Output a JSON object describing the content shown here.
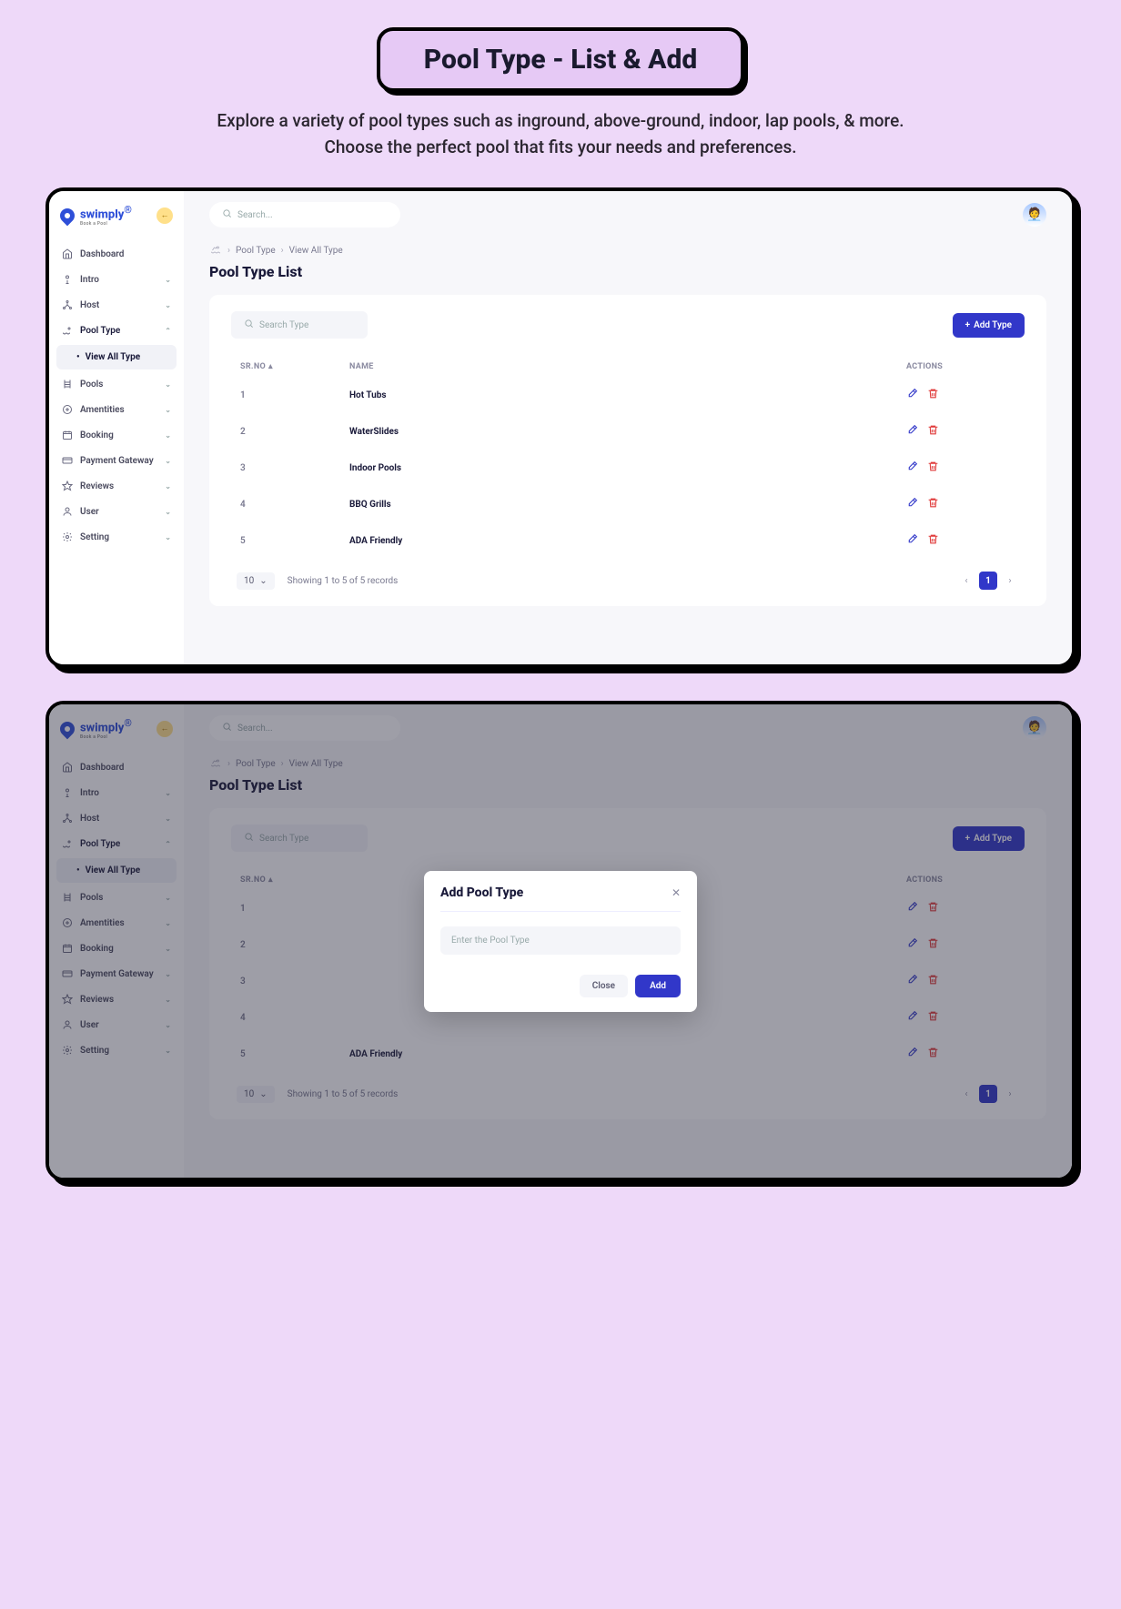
{
  "header": {
    "title": "Pool Type -  List & Add",
    "subtitle": "Explore a variety of pool types such as inground, above-ground, indoor, lap pools, & more. Choose the perfect pool that fits your needs and preferences."
  },
  "logo": {
    "name": "swimply",
    "tag": "Book a Pool",
    "trademark": "®"
  },
  "nav": {
    "items": [
      {
        "label": "Dashboard",
        "icon": "home",
        "expandable": false
      },
      {
        "label": "Intro",
        "icon": "person",
        "expandable": true
      },
      {
        "label": "Host",
        "icon": "network",
        "expandable": true
      },
      {
        "label": "Pool Type",
        "icon": "pool",
        "expandable": true,
        "open": true
      },
      {
        "label": "Pools",
        "icon": "ladder",
        "expandable": true
      },
      {
        "label": "Amentities",
        "icon": "plus-circle",
        "expandable": true
      },
      {
        "label": "Booking",
        "icon": "calendar",
        "expandable": true
      },
      {
        "label": "Payment Gateway",
        "icon": "card",
        "expandable": true
      },
      {
        "label": "Reviews",
        "icon": "star",
        "expandable": true
      },
      {
        "label": "User",
        "icon": "user",
        "expandable": true
      },
      {
        "label": "Setting",
        "icon": "gear",
        "expandable": true
      }
    ],
    "subitem": "View All Type"
  },
  "topbar": {
    "search_placeholder": "Search..."
  },
  "breadcrumb": {
    "a": "Pool Type",
    "b": "View All Type"
  },
  "page": {
    "title": "Pool Type List"
  },
  "toolbar": {
    "search_placeholder": "Search  Type",
    "add_label": "Add Type"
  },
  "table": {
    "cols": {
      "srno": "SR.NO",
      "name": "NAME",
      "actions": "ACTIONS"
    },
    "rows": [
      {
        "sr": "1",
        "name": "Hot Tubs"
      },
      {
        "sr": "2",
        "name": "WaterSlides"
      },
      {
        "sr": "3",
        "name": "Indoor Pools"
      },
      {
        "sr": "4",
        "name": "BBQ Grills"
      },
      {
        "sr": "5",
        "name": "ADA Friendly"
      }
    ],
    "perpage": "10",
    "records_text": "Showing 1 to 5 of 5 records",
    "page_current": "1"
  },
  "modal": {
    "title": "Add Pool Type",
    "placeholder": "Enter the Pool Type",
    "close": "Close",
    "add": "Add"
  },
  "colors": {
    "primary": "#3137c9",
    "danger": "#e03a3a",
    "bg": "#eed9f9"
  }
}
